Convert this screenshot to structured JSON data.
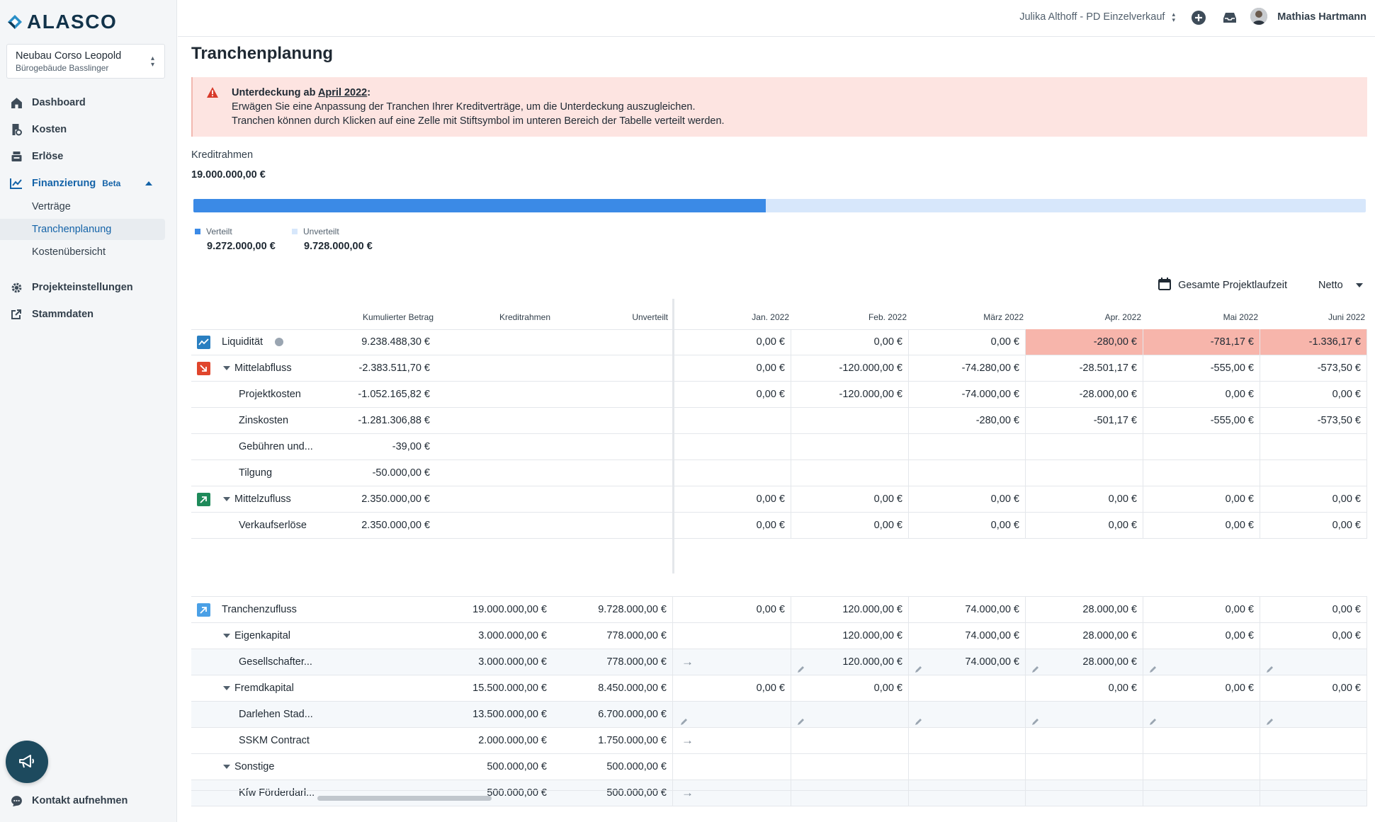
{
  "app": {
    "logo_text": "ALASCO"
  },
  "project": {
    "title": "Neubau Corso Leopold",
    "subtitle": "Bürogebäude Basslinger"
  },
  "sidebar": {
    "items": [
      {
        "label": "Dashboard",
        "icon": "home-icon"
      },
      {
        "label": "Kosten",
        "icon": "receipt-icon"
      },
      {
        "label": "Erlöse",
        "icon": "cash-register-icon"
      },
      {
        "label": "Finanzierung",
        "icon": "financing-icon",
        "badge": "Beta"
      },
      {
        "label": "Projekteinstellungen",
        "icon": "gear-icon"
      },
      {
        "label": "Stammdaten",
        "icon": "external-link-icon"
      }
    ],
    "sub_items": [
      "Verträge",
      "Tranchenplanung",
      "Kostenübersicht"
    ],
    "contact_label": "Kontakt aufnehmen"
  },
  "topbar": {
    "context": "Julika Althoff - PD Einzelverkauf",
    "user_name": "Mathias Hartmann"
  },
  "page": {
    "title": "Tranchenplanung"
  },
  "alert": {
    "title_prefix": "Unterdeckung ab ",
    "title_date": "April 2022",
    "title_suffix": ":",
    "line1": "Erwägen Sie eine Anpassung der Tranchen Ihrer Kreditverträge, um die Unterdeckung auszugleichen.",
    "line2": "Tranchen können durch Klicken auf eine Zelle mit Stiftsymbol im unteren Bereich der Tabelle verteilt werden."
  },
  "credit": {
    "label": "Kreditrahmen",
    "value": "19.000.000,00 €",
    "distributed_fraction": 0.488,
    "legend_distributed": "Verteilt",
    "distributed_value": "9.272.000,00 €",
    "legend_undistributed": "Unverteilt",
    "undistributed_value": "9.728.000,00 €",
    "colors": {
      "distributed": "#3b8ae6",
      "undistributed": "#d7e7fb"
    }
  },
  "controls": {
    "period": "Gesamte Projektlaufzeit",
    "mode": "Netto"
  },
  "table": {
    "headers": [
      "Kumulierter Betrag",
      "Kreditrahmen",
      "Unverteilt",
      "Jan. 2022",
      "Feb. 2022",
      "März 2022",
      "Apr. 2022",
      "Mai 2022",
      "Juni 2022"
    ],
    "rows": [
      {
        "label": "Liquidität",
        "kum": "9.238.488,30 €",
        "kr": "",
        "unv": "",
        "months": [
          "0,00 €",
          "0,00 €",
          "0,00 €",
          "-280,00 €",
          "-781,17 €",
          "-1.336,17 €"
        ]
      },
      {
        "label": "Mittelabfluss",
        "kum": "-2.383.511,70 €",
        "kr": "",
        "unv": "",
        "months": [
          "0,00 €",
          "-120.000,00 €",
          "-74.280,00 €",
          "-28.501,17 €",
          "-555,00 €",
          "-573,50 €"
        ]
      },
      {
        "label": "Projektkosten",
        "kum": "-1.052.165,82 €",
        "kr": "",
        "unv": "",
        "months": [
          "0,00 €",
          "-120.000,00 €",
          "-74.000,00 €",
          "-28.000,00 €",
          "0,00 €",
          "0,00 €"
        ]
      },
      {
        "label": "Zinskosten",
        "kum": "-1.281.306,88 €",
        "kr": "",
        "unv": "",
        "months": [
          "",
          "",
          "-280,00 €",
          "-501,17 €",
          "-555,00 €",
          "-573,50 €"
        ]
      },
      {
        "label": "Gebühren und...",
        "kum": "-39,00 €",
        "kr": "",
        "unv": "",
        "months": [
          "",
          "",
          "",
          "",
          "",
          ""
        ]
      },
      {
        "label": "Tilgung",
        "kum": "-50.000,00 €",
        "kr": "",
        "unv": "",
        "months": [
          "",
          "",
          "",
          "",
          "",
          ""
        ]
      },
      {
        "label": "Mittelzufluss",
        "kum": "2.350.000,00 €",
        "kr": "",
        "unv": "",
        "months": [
          "0,00 €",
          "0,00 €",
          "0,00 €",
          "0,00 €",
          "0,00 €",
          "0,00 €"
        ]
      },
      {
        "label": "Verkaufserlöse",
        "kum": "2.350.000,00 €",
        "kr": "",
        "unv": "",
        "months": [
          "0,00 €",
          "0,00 €",
          "0,00 €",
          "0,00 €",
          "0,00 €",
          "0,00 €"
        ]
      },
      {
        "label": "Tranchenzufluss",
        "kum": "",
        "kr": "19.000.000,00 €",
        "unv": "9.728.000,00 €",
        "months": [
          "0,00 €",
          "120.000,00 €",
          "74.000,00 €",
          "28.000,00 €",
          "0,00 €",
          "0,00 €"
        ]
      },
      {
        "label": "Eigenkapital",
        "kum": "",
        "kr": "3.000.000,00 €",
        "unv": "778.000,00 €",
        "months": [
          "",
          "120.000,00 €",
          "74.000,00 €",
          "28.000,00 €",
          "0,00 €",
          "0,00 €"
        ]
      },
      {
        "label": "Gesellschafter...",
        "kum": "",
        "kr": "3.000.000,00 €",
        "unv": "778.000,00 €",
        "months": [
          "",
          "120.000,00 €",
          "74.000,00 €",
          "28.000,00 €",
          "",
          ""
        ]
      },
      {
        "label": "Fremdkapital",
        "kum": "",
        "kr": "15.500.000,00 €",
        "unv": "8.450.000,00 €",
        "months": [
          "0,00 €",
          "0,00 €",
          "",
          "0,00 €",
          "0,00 €",
          "0,00 €"
        ]
      },
      {
        "label": "Darlehen Stad...",
        "kum": "",
        "kr": "13.500.000,00 €",
        "unv": "6.700.000,00 €",
        "months": [
          "",
          "",
          "",
          "",
          "",
          ""
        ]
      },
      {
        "label": "SSKM Contract",
        "kum": "",
        "kr": "2.000.000,00 €",
        "unv": "1.750.000,00 €",
        "months": [
          "",
          "",
          "",
          "",
          "",
          ""
        ]
      },
      {
        "label": "Sonstige",
        "kum": "",
        "kr": "500.000,00 €",
        "unv": "500.000,00 €",
        "months": [
          "",
          "",
          "",
          "",
          "",
          ""
        ]
      },
      {
        "label": "Kfw Förderdarl...",
        "kum": "",
        "kr": "500.000,00 €",
        "unv": "500.000,00 €",
        "months": [
          "",
          "",
          "",
          "",
          "",
          ""
        ]
      }
    ]
  }
}
